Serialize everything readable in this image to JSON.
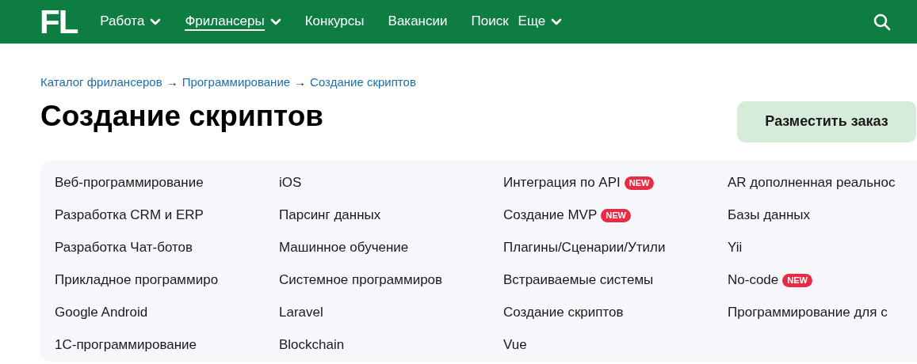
{
  "header": {
    "logo": "FL",
    "nav": [
      {
        "label": "Работа",
        "dropdown": true,
        "selected": false
      },
      {
        "label": "Фрилансеры",
        "dropdown": true,
        "selected": true
      },
      {
        "label": "Конкурсы",
        "dropdown": false,
        "selected": false
      },
      {
        "label": "Вакансии",
        "dropdown": false,
        "selected": false
      },
      {
        "label": "Поиск",
        "dropdown": false,
        "selected": false
      },
      {
        "label": "Еще",
        "dropdown": true,
        "selected": false
      }
    ]
  },
  "breadcrumbs": [
    "Каталог фрилансеров",
    "Программирование",
    "Создание скриптов"
  ],
  "breadcrumb_separator": "→",
  "title": "Создание скриптов",
  "order_button": "Разместить заказ",
  "categories": [
    [
      {
        "label": "Веб-программирование"
      },
      {
        "label": "Разработка CRM и ERP"
      },
      {
        "label": "Разработка Чат-ботов"
      },
      {
        "label": "Прикладное программиро"
      },
      {
        "label": "Google Android"
      },
      {
        "label": "1С-программирование"
      }
    ],
    [
      {
        "label": "iOS"
      },
      {
        "label": "Парсинг данных"
      },
      {
        "label": "Машинное обучение"
      },
      {
        "label": "Системное программиров"
      },
      {
        "label": "Laravel"
      },
      {
        "label": "Blockchain"
      }
    ],
    [
      {
        "label": "Интеграция по API",
        "badge": "NEW"
      },
      {
        "label": "Создание MVP",
        "badge": "NEW"
      },
      {
        "label": "Плагины/Сценарии/Утили"
      },
      {
        "label": "Встраиваемые системы"
      },
      {
        "label": "Создание скриптов"
      },
      {
        "label": "Vue"
      }
    ],
    [
      {
        "label": "AR дополненная реальнос"
      },
      {
        "label": "Базы данных"
      },
      {
        "label": "Yii"
      },
      {
        "label": "No-code",
        "badge": "NEW"
      },
      {
        "label": "Программирование для с"
      }
    ]
  ]
}
